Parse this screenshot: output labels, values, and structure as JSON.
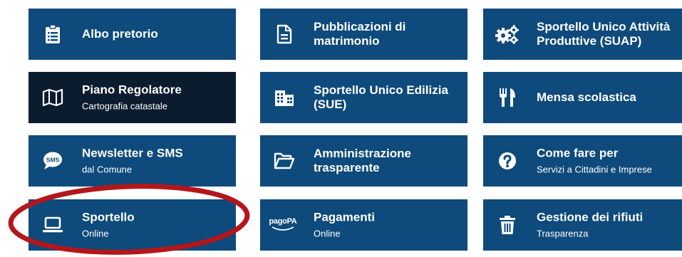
{
  "tiles": [
    {
      "title": "Albo pretorio",
      "subtitle": "",
      "icon": "clipboard-list-icon"
    },
    {
      "title": "Pubblicazioni di matrimonio",
      "subtitle": "",
      "icon": "document-icon"
    },
    {
      "title": "Sportello Unico Attività Produttive (SUAP)",
      "subtitle": "",
      "icon": "gears-icon"
    },
    {
      "title": "Piano Regolatore",
      "subtitle": "Cartografia catastale",
      "icon": "map-icon"
    },
    {
      "title": "Sportello Unico Edilizia (SUE)",
      "subtitle": "",
      "icon": "buildings-icon"
    },
    {
      "title": "Mensa scolastica",
      "subtitle": "",
      "icon": "fork-knife-icon"
    },
    {
      "title": "Newsletter e SMS",
      "subtitle": "dal Comune",
      "icon": "sms-bubble-icon"
    },
    {
      "title": "Amministrazione trasparente",
      "subtitle": "",
      "icon": "folder-open-icon"
    },
    {
      "title": "Come fare per",
      "subtitle": "Servizi a Cittadini e Imprese",
      "icon": "question-circle-icon"
    },
    {
      "title": "Sportello",
      "subtitle": "Online",
      "icon": "laptop-icon"
    },
    {
      "title": "Pagamenti",
      "subtitle": "Online",
      "icon": "pagopa-icon"
    },
    {
      "title": "Gestione dei rifiuti",
      "subtitle": "Trasparenza",
      "icon": "trash-icon"
    }
  ],
  "pagopa_logo_text": "pagoPA",
  "colors": {
    "tile_background": "#0e4a7b",
    "tile_active_background": "#0b1c2e",
    "text": "#ffffff",
    "highlight_ring": "#b3161b"
  },
  "highlighted_tile": "Sportello"
}
